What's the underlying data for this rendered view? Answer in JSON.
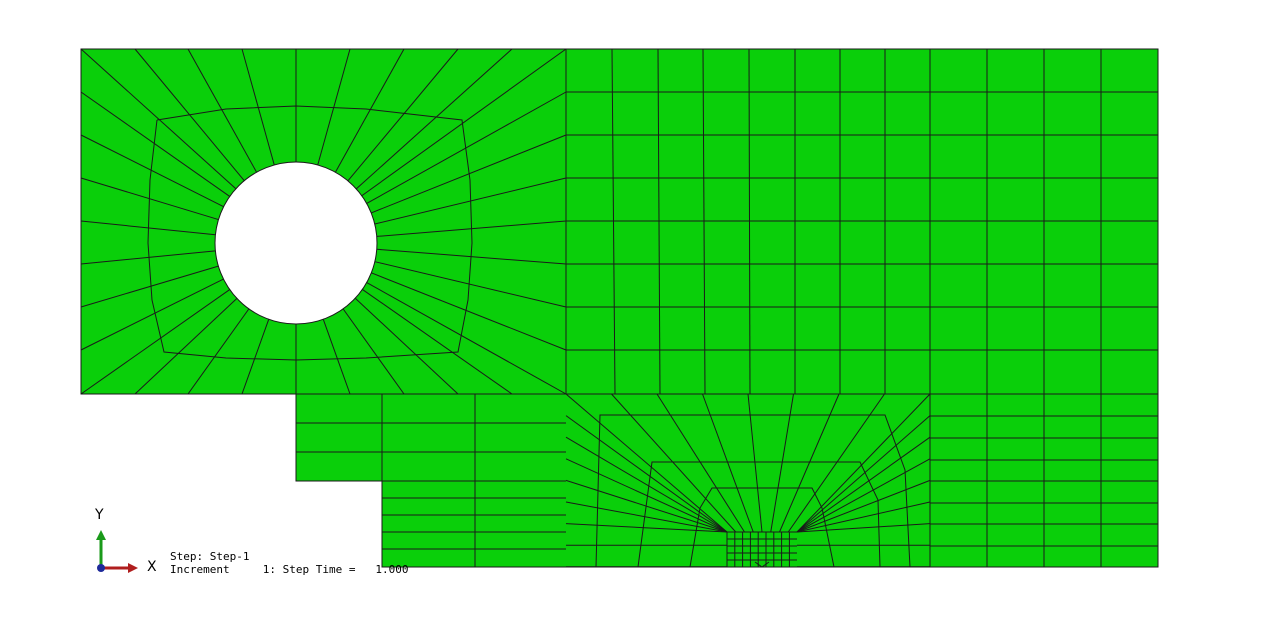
{
  "colors": {
    "mesh_fill": "#0acf0a",
    "mesh_line": "#1a1a1a",
    "background": "#ffffff",
    "axis_y": "#1a9a1a",
    "axis_x": "#b01e1e",
    "axis_origin": "#1e2a9a"
  },
  "triad": {
    "y_label": "Y",
    "x_label": "X"
  },
  "step_info": {
    "step_label": "Step: Step-1",
    "increment_prefix": "Increment",
    "increment_value": "1",
    "step_time_label": "Step Time =",
    "step_time_value": "1.000"
  }
}
